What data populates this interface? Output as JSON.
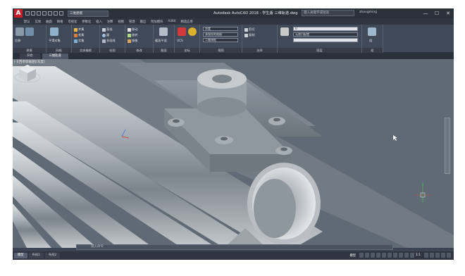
{
  "app": {
    "logo": "A",
    "title": "Autodesk AutoCAD 2018 - 学生版    三维轨道.dwg",
    "workspace": "三维建模",
    "search_placeholder": "键入关键字或短语",
    "user": "zhangming",
    "window_buttons": [
      "—",
      "☐",
      "✕"
    ]
  },
  "ribbon_tabs": [
    "默认",
    "实体",
    "曲面",
    "网格",
    "可视化",
    "参数化",
    "插入",
    "注释",
    "视图",
    "管理",
    "输出",
    "附加模块",
    "A360",
    "精选应用"
  ],
  "ribbon": {
    "panels": [
      {
        "title": "建模",
        "tools": [
          "拉伸",
          "按住并拖动",
          "长方体"
        ]
      },
      {
        "title": "网格",
        "tools": [
          "平滑对象",
          "转换"
        ]
      },
      {
        "title": "实体编辑",
        "tools": [
          "并集",
          "差集",
          "交集"
        ]
      },
      {
        "title": "绘图",
        "tools": [
          "直线",
          "圆",
          "多段线"
        ]
      },
      {
        "title": "修改",
        "tools": [
          "移动",
          "旋转",
          "镜像"
        ]
      },
      {
        "title": "截面",
        "tools": [
          "截面平面"
        ]
      },
      {
        "title": "坐标",
        "tools": [
          "UCS",
          "世界"
        ]
      },
      {
        "title": "视图",
        "tools": [
          "未保存的视图"
        ]
      },
      {
        "title": "选择",
        "tools": [
          "剪切",
          "复制"
        ]
      },
      {
        "title": "图层",
        "tools": [
          "图层特性"
        ]
      },
      {
        "title": "组",
        "tools": [
          "组"
        ]
      }
    ],
    "visual_style": "灰度",
    "layer_field": "0",
    "view_field": "无视口配置",
    "viewport_field": "二维线框",
    "section_plane": "截面平面",
    "panel_labels": [
      "建模",
      "网格",
      "实体编辑",
      "绘图",
      "修改",
      "截面",
      "坐标",
      "视图",
      "选择",
      "图层",
      "组"
    ]
  },
  "file_tabs": [
    "开始",
    "三维轨道"
  ],
  "viewport": {
    "label": "[-][西南等轴测][灰度]"
  },
  "command_line": {
    "placeholder": "键入命令"
  },
  "status": {
    "layouts": [
      "模型",
      "布局1",
      "布局2"
    ],
    "mode": "模型",
    "scale": "1:1"
  }
}
